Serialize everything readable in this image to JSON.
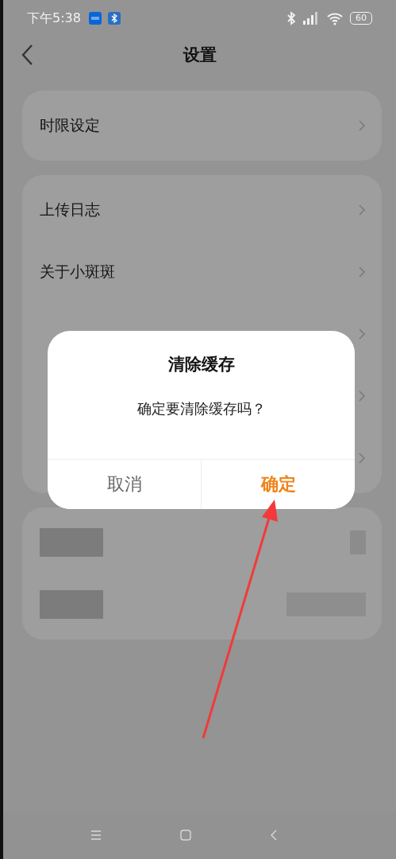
{
  "status_bar": {
    "time": "下午5:38",
    "battery": "60"
  },
  "header": {
    "title": "设置"
  },
  "groups": [
    {
      "items": [
        {
          "kind": "link",
          "label": "时限设定"
        }
      ]
    },
    {
      "items": [
        {
          "kind": "link",
          "label": "上传日志"
        },
        {
          "kind": "link",
          "label": "关于小斑斑"
        },
        {
          "kind": "link"
        },
        {
          "kind": "link"
        },
        {
          "kind": "link"
        }
      ]
    },
    {
      "items": [
        {
          "kind": "blurred"
        },
        {
          "kind": "blurred"
        }
      ]
    }
  ],
  "dialog": {
    "title": "清除缓存",
    "message": "确定要清除缓存吗？",
    "buttons": [
      {
        "label": "取消",
        "primary": false
      },
      {
        "label": "确定",
        "primary": true
      }
    ]
  }
}
